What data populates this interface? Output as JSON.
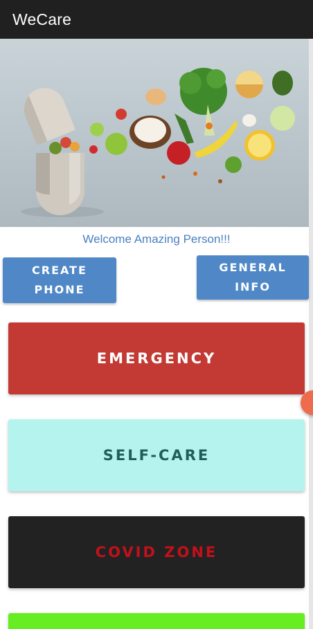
{
  "app": {
    "title": "WeCare"
  },
  "welcome_text": "Welcome Amazing Person!!!",
  "buttons": {
    "create_phone": [
      "CREATE",
      "PHONE"
    ],
    "general_info": [
      "GENERAL",
      "INFO"
    ],
    "emergency": "EMERGENCY",
    "self_care": "SELF-CARE",
    "covid_zone": "COVID ZONE"
  },
  "colors": {
    "appbar": "#202020",
    "small_button": "#4f87c7",
    "emergency": "#c23a33",
    "self_care": "#b4f3ee",
    "self_care_text": "#1f5f5a",
    "covid_zone": "#222222",
    "covid_zone_text": "#c4101a",
    "bottom_button": "#66ee22",
    "welcome_text": "#4a7fc0"
  },
  "hero_image": {
    "subject": "pill-capsule-with-fruits-and-vegetables"
  }
}
